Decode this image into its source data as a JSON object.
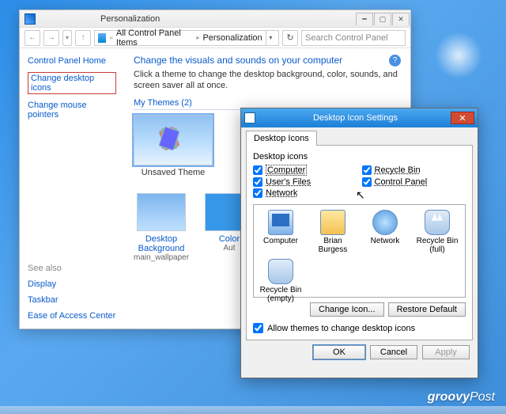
{
  "window": {
    "title": "Personalization",
    "breadcrumb_root": "All Control Panel Items",
    "breadcrumb_leaf": "Personalization",
    "search_placeholder": "Search Control Panel"
  },
  "side": {
    "home": "Control Panel Home",
    "change_icons": "Change desktop icons",
    "change_mouse": "Change mouse pointers",
    "see_also": "See also",
    "display": "Display",
    "taskbar": "Taskbar",
    "ease": "Ease of Access Center"
  },
  "main": {
    "heading": "Change the visuals and sounds on your computer",
    "sub": "Click a theme to change the desktop background, color, sounds, and screen saver all at once.",
    "my_themes": "My Themes (2)",
    "theme1": "Unsaved Theme",
    "btile1_label": "Desktop Background",
    "btile1_sub": "main_wallpaper",
    "btile2_label": "Color",
    "btile2_sub": "Aut"
  },
  "dialog": {
    "title": "Desktop Icon Settings",
    "tab": "Desktop Icons",
    "group": "Desktop icons",
    "chk_computer": "Computer",
    "chk_users": "User's Files",
    "chk_network": "Network",
    "chk_recycle": "Recycle Bin",
    "chk_cp": "Control Panel",
    "icons": {
      "computer": "Computer",
      "user": "Brian Burgess",
      "network": "Network",
      "bin_full": "Recycle Bin (full)",
      "bin_empty": "Recycle Bin (empty)"
    },
    "change_icon": "Change Icon...",
    "restore": "Restore Default",
    "allow": "Allow themes to change desktop icons",
    "ok": "OK",
    "cancel": "Cancel",
    "apply": "Apply"
  },
  "watermark": "groovyPost"
}
